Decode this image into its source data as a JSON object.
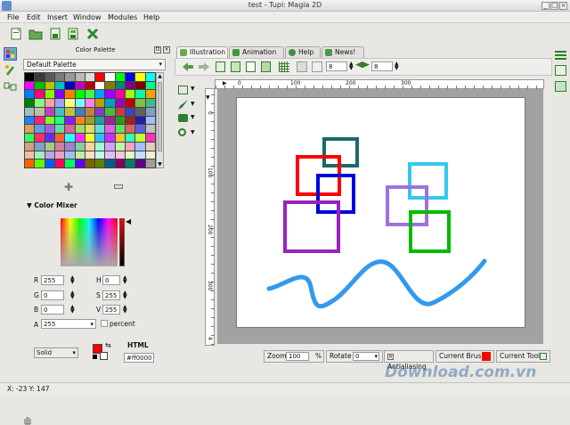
{
  "window": {
    "title": "test - Tupi: Magia 2D"
  },
  "menu": [
    "File",
    "Edit",
    "Insert",
    "Window",
    "Modules",
    "Help"
  ],
  "color_palette": {
    "title": "Color Palette",
    "selected": "Default Palette",
    "swatches": [
      "#000000",
      "#3a3a3a",
      "#5a5a5a",
      "#7a7a7a",
      "#9a9a9a",
      "#bbbbbb",
      "#dddddd",
      "#ff0000",
      "#ffffff",
      "#00ff00",
      "#0000ff",
      "#ffff00",
      "#00ffff",
      "#ff00ff",
      "#00c000",
      "#c0c000",
      "#00c0c0",
      "#0000c0",
      "#c000c0",
      "#c00000",
      "#ffffff",
      "#808000",
      "#008080",
      "#800080",
      "#800000",
      "#00ff80",
      "#0080ff",
      "#ff0080",
      "#80ff00",
      "#8000ff",
      "#ff8000",
      "#00ff00",
      "#40ff40",
      "#00a0ff",
      "#a000ff",
      "#ff00a0",
      "#a0ff00",
      "#00ffa0",
      "#ffa000",
      "#008000",
      "#80ff80",
      "#ffa0a0",
      "#a0a0ff",
      "#ffff80",
      "#80ffff",
      "#ff80ff",
      "#c0a000",
      "#00a0c0",
      "#a000c0",
      "#c00000",
      "#80c040",
      "#40c080",
      "#a0c0c0",
      "#c0c0a0",
      "#c040c0",
      "#40c0c0",
      "#c0c040",
      "#4080c0",
      "#c08040",
      "#8040c0",
      "#40c040",
      "#c04040",
      "#4040c0",
      "#606060",
      "#80a0c0",
      "#2080ff",
      "#ff2080",
      "#80ff20",
      "#20ff80",
      "#8020ff",
      "#ff8020",
      "#a0a020",
      "#20a0a0",
      "#a020a0",
      "#20a020",
      "#a02020",
      "#2020a0",
      "#a0c0ff",
      "#e0a060",
      "#60a0e0",
      "#a060e0",
      "#60e0a0",
      "#e060a0",
      "#a0e060",
      "#e0e060",
      "#60e0e0",
      "#e060e0",
      "#60e060",
      "#e06060",
      "#6060e0",
      "#c0c0c0",
      "#30ff60",
      "#ff3060",
      "#6030ff",
      "#ff6030",
      "#30ffff",
      "#ff30ff",
      "#ffff30",
      "#30c0ff",
      "#c030ff",
      "#ffc030",
      "#30ffc0",
      "#c0ff30",
      "#ff30c0",
      "#d0a080",
      "#80a0d0",
      "#a0d080",
      "#d080a0",
      "#a080d0",
      "#80d0a0",
      "#ffd0a0",
      "#a0ffd0",
      "#d0a0ff",
      "#c0ffa0",
      "#ffa0c0",
      "#a0c0ff",
      "#e0d0c0",
      "#f0c0a0",
      "#a0f0c0",
      "#c0a0f0",
      "#f0a0c0",
      "#a0c0f0",
      "#c0f0a0",
      "#ffe0c0",
      "#c0ffe0",
      "#e0c0ff",
      "#ffc0e0",
      "#e0ffc0",
      "#c0e0ff",
      "#f0f0d0",
      "#ff6000",
      "#60ff00",
      "#0060ff",
      "#ff0060",
      "#00ff60",
      "#6000ff",
      "#806000",
      "#608000",
      "#006080",
      "#800060",
      "#008060",
      "#600080",
      "#a0a0a0"
    ]
  },
  "color_mixer": {
    "title": "Color Mixer",
    "R": "255",
    "G": "0",
    "B": "0",
    "H": "0",
    "S": "255",
    "V": "255",
    "A": "255",
    "percent_label": "percent",
    "fill": "Solid",
    "html_label": "HTML",
    "html_value": "#ff0000"
  },
  "tabs": [
    {
      "label": "Illustration",
      "color": "#6aa84f"
    },
    {
      "label": "Animation",
      "color": "#3d9a3d"
    },
    {
      "label": "Help",
      "color": "#3f8f3f"
    },
    {
      "label": "News!",
      "color": "#4a9a4a"
    }
  ],
  "toolbar2": {
    "spin1": "8",
    "spin2": "8"
  },
  "ruler": {
    "top": [
      "0",
      "100",
      "200",
      "300"
    ],
    "left": [
      "0",
      "100",
      "200",
      "300",
      "4"
    ]
  },
  "bottom": {
    "zoom_label": "Zoom",
    "zoom_value": "100",
    "zoom_unit": "%",
    "rotate_label": "Rotate",
    "rotate_value": "0",
    "antialias_label": "Antialiasing",
    "current_brush_label": "Current Brush",
    "current_tool_label": "Current Tool"
  },
  "status": {
    "coords": "X: -23 Y: 147"
  },
  "watermark": "Download.com.vn",
  "drawing": {
    "shapes": [
      {
        "color": "#1a6a6a"
      },
      {
        "color": "#ff0000"
      },
      {
        "color": "#0000dd"
      },
      {
        "color": "#9a22c0"
      },
      {
        "color": "#33c8f0"
      },
      {
        "color": "#a070e0"
      },
      {
        "color": "#00bb00"
      },
      {
        "color": "#3399ee"
      }
    ]
  }
}
